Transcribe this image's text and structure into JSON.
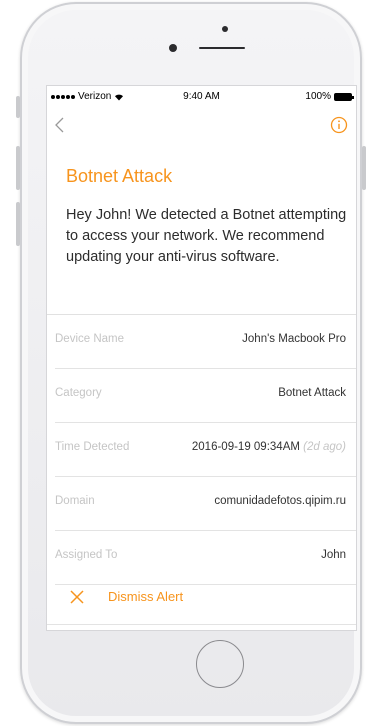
{
  "statusbar": {
    "carrier": "Verizon",
    "time": "9:40 AM",
    "battery": "100%"
  },
  "alert": {
    "title": "Botnet Attack",
    "message": "Hey John! We detected a Botnet attempting to access your network.  We recommend updating your anti-virus software."
  },
  "details": [
    {
      "label": "Device Name",
      "value": "John's Macbook Pro",
      "extra": ""
    },
    {
      "label": "Category",
      "value": "Botnet Attack",
      "extra": ""
    },
    {
      "label": "Time Detected",
      "value": "2016-09-19 09:34AM",
      "extra": "(2d ago)"
    },
    {
      "label": "Domain",
      "value": "comunidadefotos.qipim.ru",
      "extra": ""
    },
    {
      "label": "Assigned To",
      "value": "John",
      "extra": ""
    }
  ],
  "actions": {
    "dismiss_label": "Dismiss Alert"
  },
  "colors": {
    "accent": "#f7941d",
    "label": "#c5c5c5",
    "text": "#2c2c2c"
  },
  "icons": {
    "back": "chevron-left-icon",
    "info": "info-circle-icon",
    "dismiss": "close-icon"
  }
}
